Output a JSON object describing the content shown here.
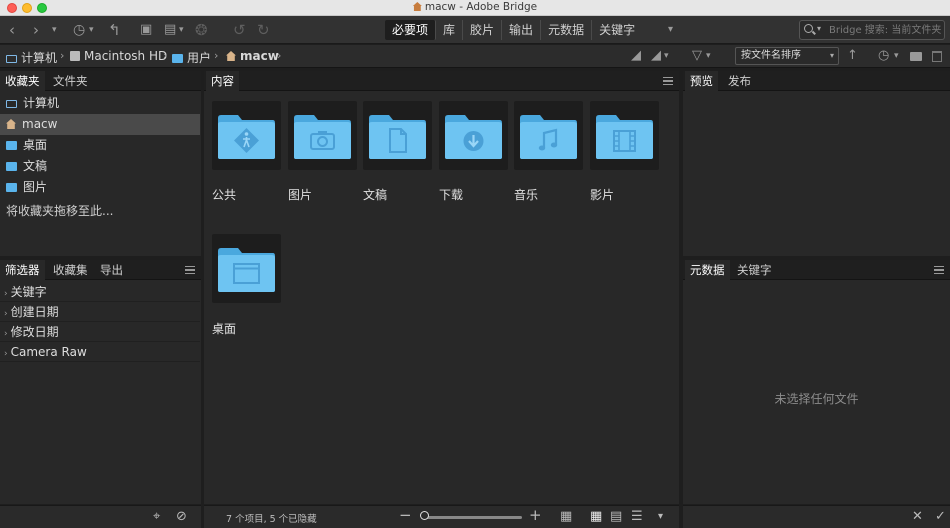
{
  "window": {
    "title": "macw - Adobe Bridge"
  },
  "toolbar": {
    "workspace_tabs": [
      "必要项",
      "库",
      "胶片",
      "输出",
      "元数据",
      "关键字"
    ],
    "active_workspace": "必要项",
    "search_placeholder": "Bridge 搜索: 当前文件夹"
  },
  "pathbar": {
    "crumbs": [
      "计算机",
      "Macintosh HD",
      "用户",
      "macw"
    ],
    "sort_label": "按文件名排序"
  },
  "favorites_panel": {
    "tabs": [
      "收藏夹",
      "文件夹"
    ],
    "items": [
      "计算机",
      "macw",
      "桌面",
      "文稿",
      "图片"
    ],
    "selected": "macw",
    "drop_hint": "将收藏夹拖移至此..."
  },
  "filter_panel": {
    "tabs": [
      "筛选器",
      "收藏集",
      "导出"
    ],
    "rows": [
      "关键字",
      "创建日期",
      "修改日期",
      "Camera Raw"
    ]
  },
  "content_panel": {
    "tab": "内容",
    "items": [
      {
        "label": "公共",
        "icon": "public-folder-icon"
      },
      {
        "label": "图片",
        "icon": "camera-folder-icon"
      },
      {
        "label": "文稿",
        "icon": "document-folder-icon"
      },
      {
        "label": "下载",
        "icon": "download-folder-icon"
      },
      {
        "label": "音乐",
        "icon": "music-folder-icon"
      },
      {
        "label": "影片",
        "icon": "film-folder-icon"
      },
      {
        "label": "桌面",
        "icon": "desktop-folder-icon"
      }
    ],
    "status": "7 个项目, 5 个已隐藏"
  },
  "preview_panel": {
    "tabs": [
      "预览",
      "发布"
    ]
  },
  "metadata_panel": {
    "tabs": [
      "元数据",
      "关键字"
    ],
    "empty_text": "未选择任何文件"
  },
  "colors": {
    "folder_blue": "#6ec4f2",
    "folder_blue_dark": "#4aa8de",
    "background": "#282828"
  }
}
